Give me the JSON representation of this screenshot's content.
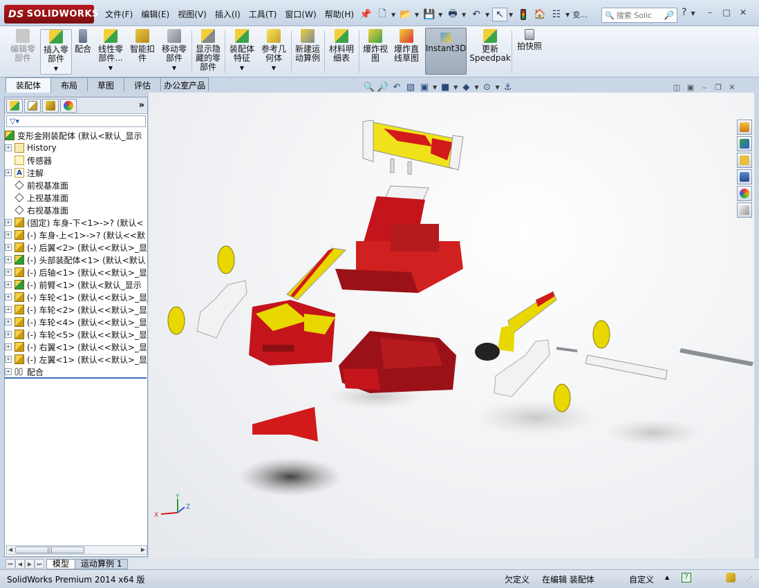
{
  "app": {
    "logo": "SOLIDWORKS",
    "logo_mark": "DS"
  },
  "menu": [
    "文件(F)",
    "编辑(E)",
    "视图(V)",
    "插入(I)",
    "工具(T)",
    "窗口(W)",
    "帮助(H)"
  ],
  "quick_access": {
    "more": "变..."
  },
  "search": {
    "placeholder": "搜索 Solic"
  },
  "help": "?",
  "ribbon": {
    "edit_component": "编辑零\n部件",
    "insert_component": "插入零\n部件",
    "mate": "配合",
    "linear_pattern": "线性零\n部件...",
    "smart_fasteners": "智能扣\n件",
    "move_component": "移动零\n部件",
    "show_hidden": "显示隐\n藏的零\n部件",
    "assembly_features": "装配体\n特征",
    "reference_geometry": "参考几\n何体",
    "new_motion_study": "新建运\n动算例",
    "bom": "材料明\n细表",
    "exploded_view": "爆炸视\n图",
    "explode_line_sketch": "爆炸直\n线草图",
    "instant3d": "Instant3D",
    "update_speedpak": "更新\nSpeedpak",
    "snapshot": "拍快照"
  },
  "command_tabs": [
    "装配体",
    "布局",
    "草图",
    "评估",
    "办公室产品"
  ],
  "feature_tree": {
    "root": "变形金刚装配体 (默认<默认_显示",
    "items": [
      {
        "label": "History",
        "icon": "history-icon",
        "expand": true
      },
      {
        "label": "传感器",
        "icon": "sensor-icon",
        "expand": false
      },
      {
        "label": "注解",
        "icon": "annotation-icon",
        "expand": true
      },
      {
        "label": "前视基准面",
        "icon": "plane-icon",
        "expand": false
      },
      {
        "label": "上视基准面",
        "icon": "plane-icon",
        "expand": false
      },
      {
        "label": "右视基准面",
        "icon": "plane-icon",
        "expand": false
      },
      {
        "label": "(固定) 车身-下<1>->? (默认<",
        "icon": "part-icon",
        "expand": true
      },
      {
        "label": "(-) 车身-上<1>->? (默认<<默",
        "icon": "part-icon",
        "expand": true
      },
      {
        "label": "(-) 后翼<2> (默认<<默认>_显",
        "icon": "part-icon",
        "expand": true
      },
      {
        "label": "(-) 头部装配体<1> (默认<默认",
        "icon": "assembly-icon",
        "expand": true
      },
      {
        "label": "(-) 后轴<1> (默认<<默认>_显",
        "icon": "part-icon",
        "expand": true
      },
      {
        "label": "(-) 前臂<1> (默认<默认_显示",
        "icon": "assembly-icon",
        "expand": true
      },
      {
        "label": "(-) 车轮<1> (默认<<默认>_显",
        "icon": "part-icon",
        "expand": true
      },
      {
        "label": "(-) 车轮<2> (默认<<默认>_显",
        "icon": "part-icon",
        "expand": true
      },
      {
        "label": "(-) 车轮<4> (默认<<默认>_显",
        "icon": "part-icon",
        "expand": true
      },
      {
        "label": "(-) 车轮<5> (默认<<默认>_显",
        "icon": "part-icon",
        "expand": true
      },
      {
        "label": "(-) 右翼<1> (默认<<默认>_显",
        "icon": "part-icon",
        "expand": true
      },
      {
        "label": "(-) 左翼<1> (默认<<默认>_显",
        "icon": "part-icon",
        "expand": true
      },
      {
        "label": "配合",
        "icon": "mates-icon",
        "expand": true
      }
    ]
  },
  "bottom_tabs": [
    "模型",
    "运动算例 1"
  ],
  "status": {
    "product": "SolidWorks Premium 2014 x64 版",
    "underdefined": "欠定义",
    "editing": "在编辑 装配体",
    "custom": "自定义"
  },
  "triad": {
    "x": "X",
    "y": "Y",
    "z": "Z"
  },
  "colors": {
    "accent_red": "#c4151c",
    "part_yellow": "#e8d800",
    "dark_red": "#9a1218",
    "white_part": "#f2f2f2"
  }
}
